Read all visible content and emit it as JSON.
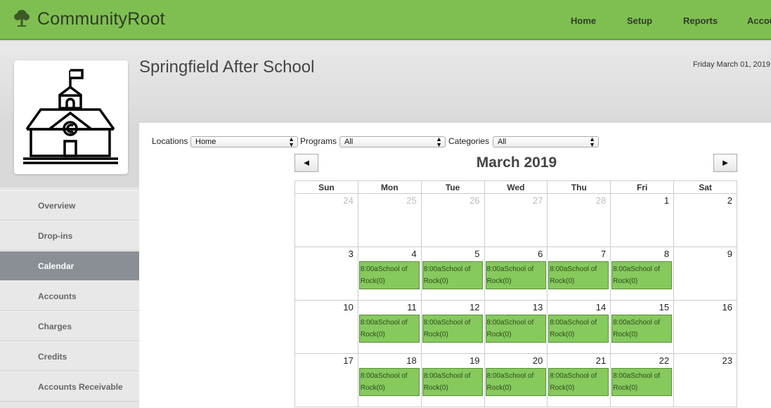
{
  "app": {
    "brand": "CommunityRoot"
  },
  "nav": [
    {
      "label": "Home",
      "name": "nav-home"
    },
    {
      "label": "Setup",
      "name": "nav-setup"
    },
    {
      "label": "Reports",
      "name": "nav-reports"
    },
    {
      "label": "Accou",
      "name": "nav-accounts"
    }
  ],
  "header": {
    "org_name": "Springfield After School",
    "date": "Friday March 01, 2019"
  },
  "sidebar": {
    "items": [
      {
        "label": "Overview",
        "active": false
      },
      {
        "label": "Drop-ins",
        "active": false
      },
      {
        "label": "Calendar",
        "active": true
      },
      {
        "label": "Accounts",
        "active": false
      },
      {
        "label": "Charges",
        "active": false
      },
      {
        "label": "Credits",
        "active": false
      },
      {
        "label": "Accounts Receivable",
        "active": false
      }
    ]
  },
  "filters": {
    "locations": {
      "label": "Locations",
      "value": "Home"
    },
    "programs": {
      "label": "Programs",
      "value": "All"
    },
    "categories": {
      "label": "Categories",
      "value": "All"
    }
  },
  "calendar": {
    "prev_label": "◄",
    "next_label": "►",
    "month_title": "March 2019",
    "weekdays": [
      "Sun",
      "Mon",
      "Tue",
      "Wed",
      "Thu",
      "Fri",
      "Sat"
    ],
    "weeks": [
      [
        {
          "day": "24",
          "muted": true
        },
        {
          "day": "25",
          "muted": true
        },
        {
          "day": "26",
          "muted": true
        },
        {
          "day": "27",
          "muted": true
        },
        {
          "day": "28",
          "muted": true
        },
        {
          "day": "1"
        },
        {
          "day": "2"
        }
      ],
      [
        {
          "day": "3"
        },
        {
          "day": "4",
          "event": "8:00aSchool of Rock(0)"
        },
        {
          "day": "5",
          "event": "8:00aSchool of Rock(0)"
        },
        {
          "day": "6",
          "event": "8:00aSchool of Rock(0)"
        },
        {
          "day": "7",
          "event": "8:00aSchool of Rock(0)"
        },
        {
          "day": "8",
          "event": "8:00aSchool of Rock(0)"
        },
        {
          "day": "9"
        }
      ],
      [
        {
          "day": "10"
        },
        {
          "day": "11",
          "event": "8:00aSchool of Rock(0)"
        },
        {
          "day": "12",
          "event": "8:00aSchool of Rock(0)"
        },
        {
          "day": "13",
          "event": "8:00aSchool of Rock(0)"
        },
        {
          "day": "14",
          "event": "8:00aSchool of Rock(0)"
        },
        {
          "day": "15",
          "event": "8:00aSchool of Rock(0)"
        },
        {
          "day": "16"
        }
      ],
      [
        {
          "day": "17"
        },
        {
          "day": "18",
          "event": "8:00aSchool of Rock(0)"
        },
        {
          "day": "19",
          "event": "8:00aSchool of Rock(0)"
        },
        {
          "day": "20",
          "event": "8:00aSchool of Rock(0)"
        },
        {
          "day": "21",
          "event": "8:00aSchool of Rock(0)"
        },
        {
          "day": "22",
          "event": "8:00aSchool of Rock(0)"
        },
        {
          "day": "23"
        }
      ]
    ]
  }
}
